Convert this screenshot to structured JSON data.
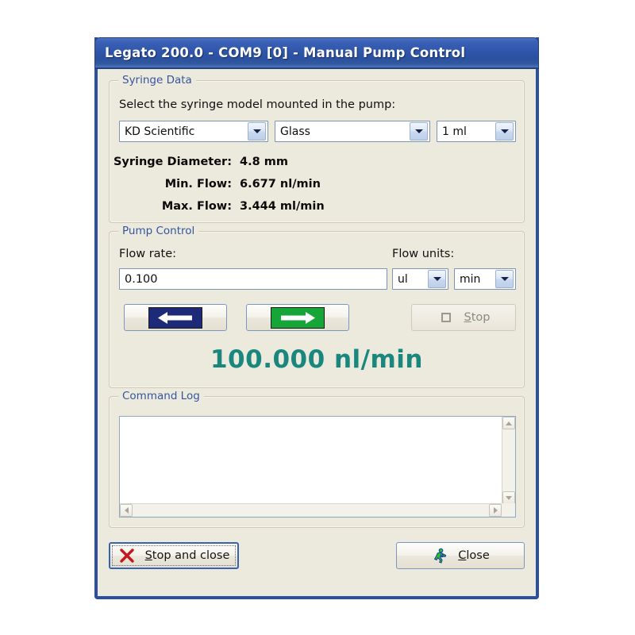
{
  "window": {
    "title": "Legato 200.0 - COM9 [0] - Manual Pump Control",
    "border_color": "#2c4f9e",
    "titlebar_color": "#2f56ab",
    "client_bg": "#ece9dd"
  },
  "syringe_data": {
    "group_label": "Syringe Data",
    "instruction": "Select the syringe model mounted in the pump:",
    "manufacturer_combo": {
      "value": "KD Scientific",
      "icon": "chevron-down-icon"
    },
    "material_combo": {
      "value": "Glass",
      "icon": "chevron-down-icon"
    },
    "volume_combo": {
      "value": "1 ml",
      "icon": "chevron-down-icon"
    },
    "fields": [
      {
        "label": "Syringe Diameter:",
        "value": "4.8 mm"
      },
      {
        "label": "Min. Flow:",
        "value": "6.677 nl/min"
      },
      {
        "label": "Max. Flow:",
        "value": "3.444 ml/min"
      }
    ]
  },
  "pump_control": {
    "group_label": "Pump Control",
    "flow_rate_label": "Flow rate:",
    "flow_rate_value": "0.100",
    "flow_units_label": "Flow units:",
    "volume_unit_combo": {
      "value": "ul",
      "icon": "chevron-down-icon"
    },
    "time_unit_combo": {
      "value": "min",
      "icon": "chevron-down-icon"
    },
    "withdraw_button": {
      "icon": "arrow-left-icon",
      "color": "#1c2a78"
    },
    "infuse_button": {
      "icon": "arrow-right-icon",
      "color": "#16a637"
    },
    "stop_button": {
      "label": "Stop",
      "accel": "S",
      "icon": "stop-square-icon",
      "enabled": false
    },
    "readout": {
      "value": "100.000 nl/min",
      "color": "#19877d"
    }
  },
  "command_log": {
    "group_label": "Command Log",
    "content": "",
    "vertical_scrollbar": {
      "up_icon": "scroll-up-icon",
      "down_icon": "scroll-down-icon"
    },
    "horizontal_scrollbar": {
      "left_icon": "scroll-left-icon",
      "right_icon": "scroll-right-icon"
    }
  },
  "footer": {
    "stop_and_close": {
      "label": "Stop and close",
      "accel": "S",
      "icon": "red-x-icon",
      "focused": true
    },
    "close": {
      "label": "Close",
      "accel": "C",
      "icon": "exit-running-man-icon"
    }
  }
}
